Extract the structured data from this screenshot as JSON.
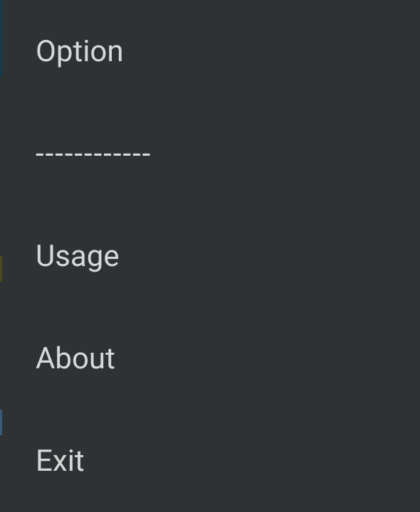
{
  "menu": {
    "items": [
      {
        "label": "Option"
      },
      {
        "label": "------------"
      },
      {
        "label": "Usage"
      },
      {
        "label": "About"
      },
      {
        "label": "Exit"
      }
    ]
  }
}
